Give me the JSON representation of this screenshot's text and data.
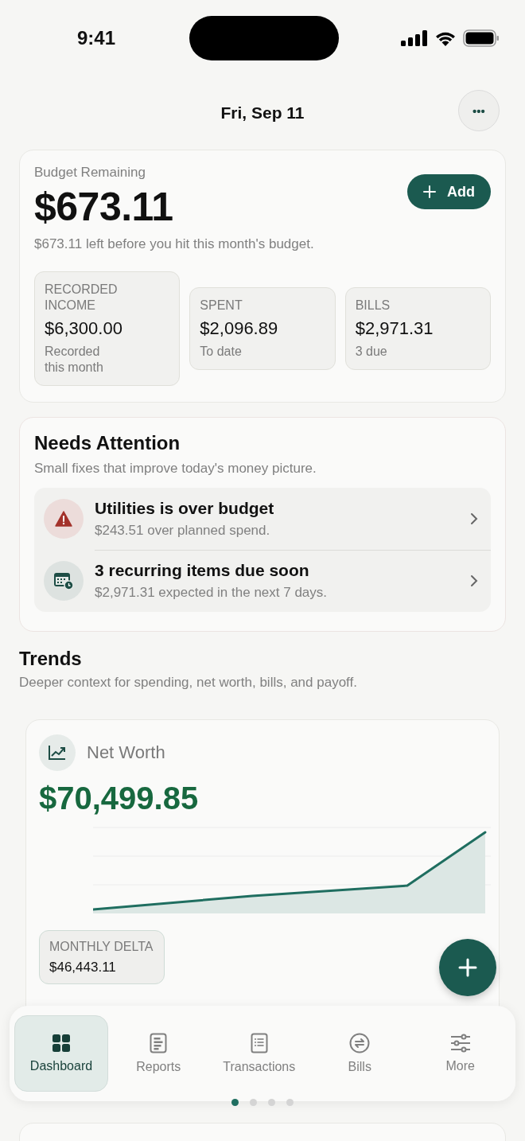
{
  "status_bar": {
    "time": "9:41"
  },
  "header": {
    "date": "Fri, Sep 11",
    "more_button": "•••"
  },
  "budget": {
    "label": "Budget Remaining",
    "amount": "$673.11",
    "add_button": "Add",
    "note": "$673.11 left before you hit this month's budget.",
    "stats": [
      {
        "label": "RECORDED INCOME",
        "value": "$6,300.00",
        "caption": "Recorded this month"
      },
      {
        "label": "SPENT",
        "value": "$2,096.89",
        "caption": "To date"
      },
      {
        "label": "BILLS",
        "value": "$2,971.31",
        "caption": "3 due"
      }
    ]
  },
  "attention": {
    "title": "Needs Attention",
    "subtitle": "Small fixes that improve today's money picture.",
    "items": [
      {
        "kind": "warning",
        "title": "Utilities is over budget",
        "detail": "$243.51 over planned spend."
      },
      {
        "kind": "calendar",
        "title": "3 recurring items due soon",
        "detail": "$2,971.31 expected in the next 7 days."
      }
    ]
  },
  "trends": {
    "title": "Trends",
    "subtitle": "Deeper context for spending, net worth, bills, and payoff."
  },
  "net_worth": {
    "title": "Net Worth",
    "amount": "$70,499.85",
    "delta": {
      "label": "MONTHLY DELTA",
      "value": "$46,443.11"
    }
  },
  "tab_bar": {
    "tabs": [
      {
        "label": "Dashboard",
        "selected": true
      },
      {
        "label": "Reports",
        "selected": false
      },
      {
        "label": "Transactions",
        "selected": false
      },
      {
        "label": "Bills",
        "selected": false
      },
      {
        "label": "More",
        "selected": false
      }
    ]
  },
  "pager": {
    "pages": [
      {
        "selected": true
      },
      {
        "selected": false
      },
      {
        "selected": false
      },
      {
        "selected": false
      }
    ]
  }
}
